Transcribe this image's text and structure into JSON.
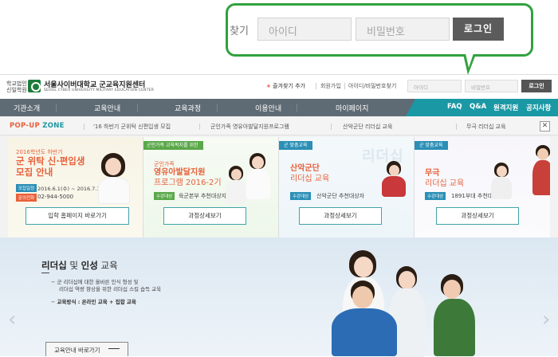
{
  "callout": {
    "clipped_text": "찾기",
    "id_placeholder": "아이디",
    "pw_placeholder": "비밀번호",
    "login_label": "로그인"
  },
  "header": {
    "logo_small_1": "학교법인",
    "logo_small_2": "신일학원",
    "logo_title": "서울사이버대학교 군교육지원센터",
    "logo_subtitle": "SEOUL CYBER UNIVERSITY MILITARY EDUCATION CENTER",
    "favorites": "즐겨찾기 추가",
    "join": "회원가입",
    "find_account": "아이디/비밀번호찾기",
    "id_placeholder": "아이디",
    "pw_placeholder": "비밀번호",
    "login_label": "로그인"
  },
  "nav": {
    "items": [
      "기관소개",
      "교육안내",
      "교육과정",
      "이용안내",
      "마이페이지"
    ],
    "right_items": [
      "FAQ",
      "Q&A",
      "원격지원",
      "공지사항"
    ]
  },
  "popup_zone": {
    "title_prefix": "POP-UP",
    "title_suffix": " ZONE",
    "tabs": [
      "'16 하반기 군위탁 신편입생 모집",
      "군인가족 영유아발달지원프로그램",
      "산악군단 리더십 교육",
      "무극 리더십 교육"
    ],
    "close": "✕",
    "cards": [
      {
        "small": "2016학년도 하반기",
        "big1": "군 위탁 신·편입생",
        "big2": "모집 안내",
        "badge1": "모집일정",
        "info1": "2016.6.1(수) ~ 2016.7.12(화)",
        "badge2": "문의전화",
        "info2": "02-944-5000",
        "button": "입학 홈페이지 바로가기"
      },
      {
        "tag": "군인가족 교육복지를 위한",
        "small": "군인가족",
        "big1": "영유아발달지원",
        "big2": "프로그램 2016-2기",
        "badge1": "수강대상",
        "info1": "육군본부 추천대상자",
        "button": "과정상세보기"
      },
      {
        "tag": "군 맞춤교육",
        "watermark": "리더십",
        "big1": "산악군단",
        "big2": "리더십 교육",
        "badge1": "수강대상",
        "info1": "산악군단 추천대상자",
        "button": "과정상세보기"
      },
      {
        "tag": "군 맞춤교육",
        "big1": "무극",
        "big2": "리더십 교육",
        "badge1": "수강대상",
        "info1": "1891부대 추천대상자",
        "button": "과정상세보기"
      }
    ]
  },
  "hero": {
    "title_bold1": "리더십",
    "title_mid": " 및 ",
    "title_bold2": "인성",
    "title_end": " 교육",
    "line1": "군 리더십에 대한 올바른 인식 형성 및",
    "line2": "리더십 역량 향상을 위한 리더십 스킬 습득 교육",
    "method": "교육방식 : 온라인 교육 + 집합 교육",
    "button": "교육안내 바로가기",
    "prev": "‹",
    "next": "›"
  },
  "colors": {
    "callout_border": "#31a13e",
    "nav_bg": "#5f6b74",
    "nav_accent": "#1a98a4",
    "popup_accent": "#e8603a",
    "card_button_border": "#3fa3a8"
  }
}
